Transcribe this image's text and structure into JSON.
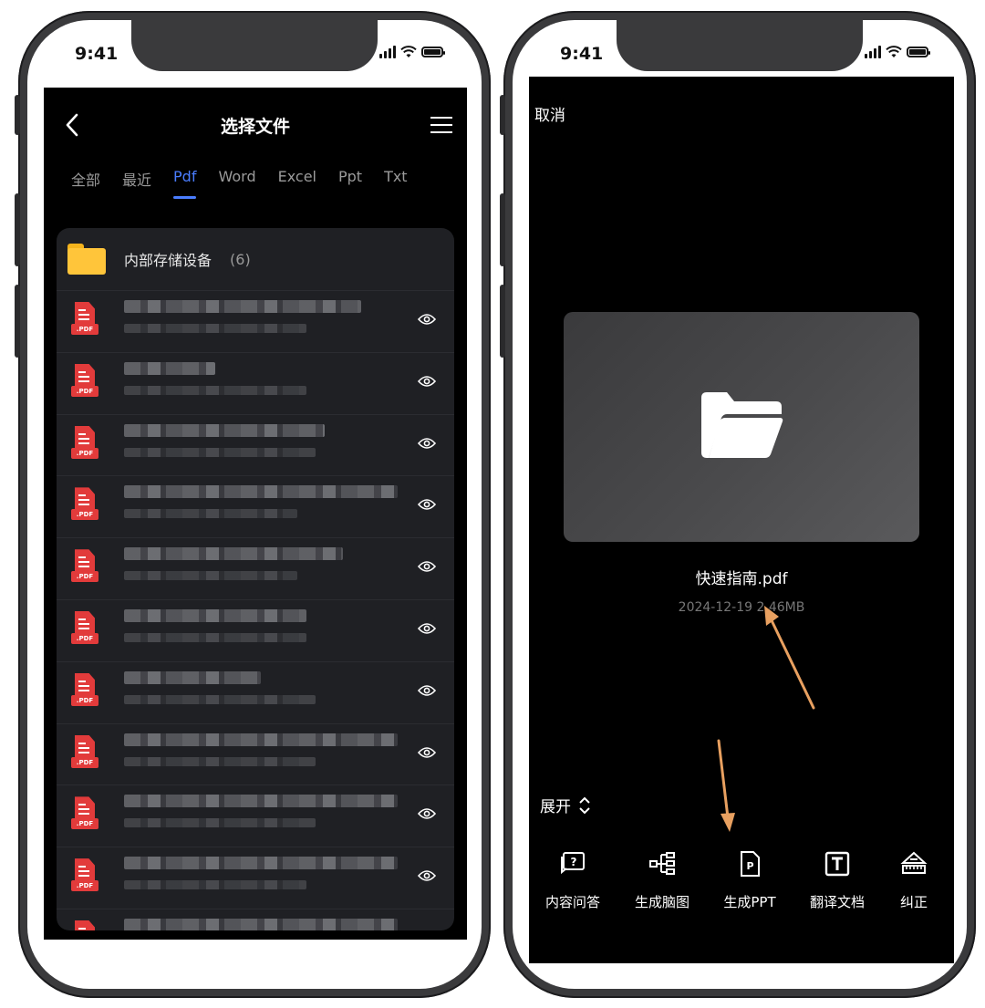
{
  "status": {
    "time": "9:41"
  },
  "left": {
    "title": "选择文件",
    "tabs": [
      {
        "label": "全部",
        "active": false
      },
      {
        "label": "最近",
        "active": false
      },
      {
        "label": "Pdf",
        "active": true
      },
      {
        "label": "Word",
        "active": false
      },
      {
        "label": "Excel",
        "active": false
      },
      {
        "label": "Ppt",
        "active": false
      },
      {
        "label": "Txt",
        "active": false
      }
    ],
    "folder": {
      "label": "内部存储设备",
      "count": "(6)"
    },
    "file_icon_tag": ".PDF",
    "accent": "#4a7dff"
  },
  "right": {
    "cancel": "取消",
    "file_name": "快速指南.pdf",
    "file_meta": "2024-12-19  2.46MB",
    "expand": "展开",
    "tools": [
      {
        "label": "内容问答",
        "icon": "qa-icon"
      },
      {
        "label": "生成脑图",
        "icon": "mindmap-icon"
      },
      {
        "label": "生成PPT",
        "icon": "ppt-icon"
      },
      {
        "label": "翻译文档",
        "icon": "translate-icon"
      },
      {
        "label": "纠正",
        "icon": "correct-icon"
      }
    ],
    "annotation_color": "#e8a060"
  }
}
